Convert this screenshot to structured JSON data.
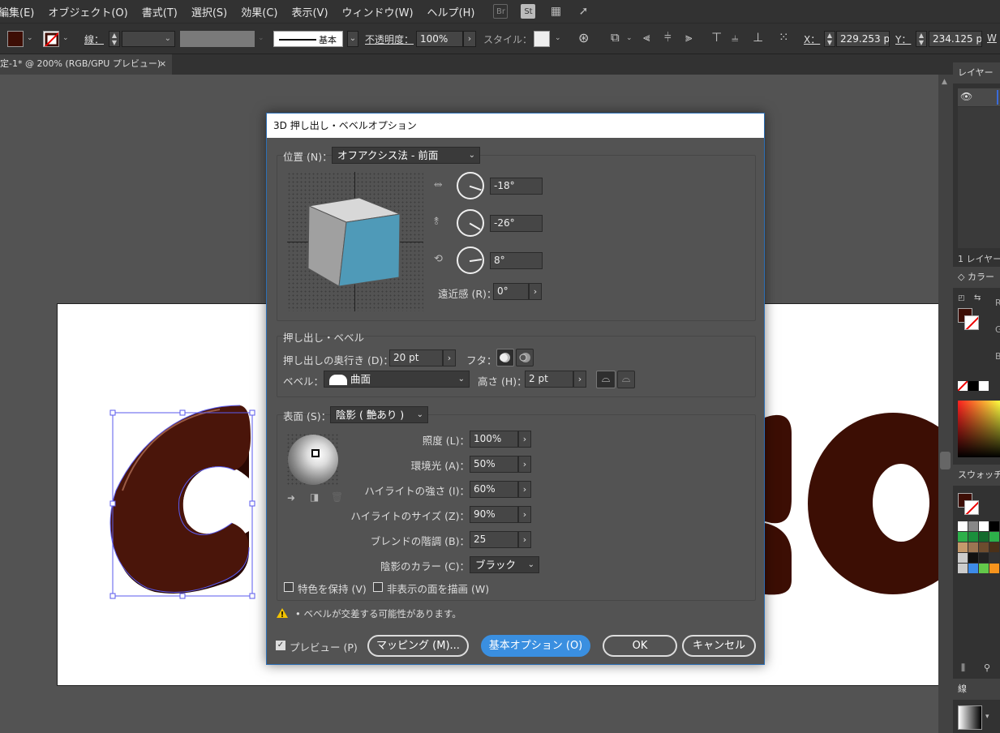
{
  "menu": [
    "編集(E)",
    "オブジェクト(O)",
    "書式(T)",
    "選択(S)",
    "効果(C)",
    "表示(V)",
    "ウィンドウ(W)",
    "ヘルプ(H)"
  ],
  "menu_icons": {
    "br": "Br",
    "st": "St"
  },
  "control": {
    "stroke_label": "線：",
    "stroke_style": "基本",
    "opacity_label": "不透明度：",
    "opacity": "100%",
    "style_label": "スタイル：",
    "x_label": "X：",
    "x_value": "229.253 p",
    "y_label": "Y：",
    "y_value": "234.125 p",
    "w_label": "W",
    "fill_color": "#3d0e05"
  },
  "document_tab": {
    "title": "定-1* @ 200% (RGB/GPU プレビュー)",
    "close": "×"
  },
  "panels": {
    "layers_tab": "レイヤー",
    "layers_count": "1 レイヤー",
    "color_tab": "カラー",
    "color_channels": [
      "R",
      "G",
      "B"
    ],
    "swatches_tab": "スウォッチ",
    "stroke_tab": "線"
  },
  "dialog": {
    "title": "3D 押し出し・ベベルオプション",
    "position_label": "位置 (N)：",
    "position_value": "オフアクシス法 - 前面",
    "rot_x": "-18°",
    "rot_y": "-26°",
    "rot_z": "8°",
    "perspective_label": "遠近感 (R)：",
    "perspective_value": "0°",
    "extrude_section": "押し出し・ベベル",
    "depth_label": "押し出しの奥行き (D)：",
    "depth_value": "20 pt",
    "cap_label": "フタ：",
    "bevel_label": "ベベル：",
    "bevel_value": "曲面",
    "height_label": "高さ (H)：",
    "height_value": "2 pt",
    "surface_label": "表面 (S)：",
    "surface_value": "陰影 ( 艶あり )",
    "light_intensity_label": "照度 (L)：",
    "light_intensity": "100%",
    "ambient_label": "環境光 (A)：",
    "ambient": "50%",
    "highlight_intensity_label": "ハイライトの強さ (I)：",
    "highlight_intensity": "60%",
    "highlight_size_label": "ハイライトのサイズ (Z)：",
    "highlight_size": "90%",
    "blend_steps_label": "ブレンドの階調 (B)：",
    "blend_steps": "25",
    "shading_color_label": "陰影のカラー (C)：",
    "shading_color": "ブラック",
    "preserve_spot_label": "特色を保持 (V)",
    "draw_hidden_label": "非表示の面を描画 (W)",
    "warning": "• ベベルが交差する可能性があります。",
    "preview_label": "プレビュー (P)",
    "mapping_btn": "マッピング (M)...",
    "basic_options_btn": "基本オプション (O)",
    "ok_btn": "OK",
    "cancel_btn": "キャンセル",
    "cube_front_color": "#4f9ab8"
  },
  "artwork": {
    "fill_color": "#3c0e04"
  }
}
